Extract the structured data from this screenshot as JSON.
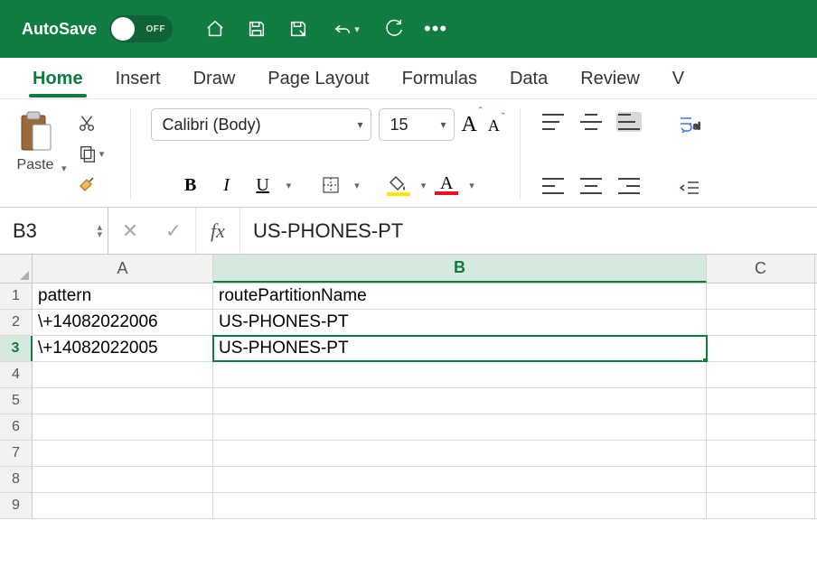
{
  "titlebar": {
    "autosave_label": "AutoSave",
    "autosave_state": "OFF"
  },
  "tabs": [
    "Home",
    "Insert",
    "Draw",
    "Page Layout",
    "Formulas",
    "Data",
    "Review",
    "V"
  ],
  "active_tab": 0,
  "ribbon": {
    "paste_label": "Paste",
    "font_name": "Calibri (Body)",
    "font_size": "15"
  },
  "name_box": "B3",
  "formula_bar_value": "US-PHONES-PT",
  "columns": [
    "A",
    "B",
    "C"
  ],
  "sheet": {
    "headers": {
      "A": "pattern",
      "B": "routePartitionName"
    },
    "rows": [
      {
        "A": "\\+14082022006",
        "B": "US-PHONES-PT"
      },
      {
        "A": "\\+14082022005",
        "B": "US-PHONES-PT"
      }
    ]
  },
  "active_cell": {
    "col": "B",
    "row": 3
  },
  "selected_col": "B",
  "total_rows_shown": 9
}
